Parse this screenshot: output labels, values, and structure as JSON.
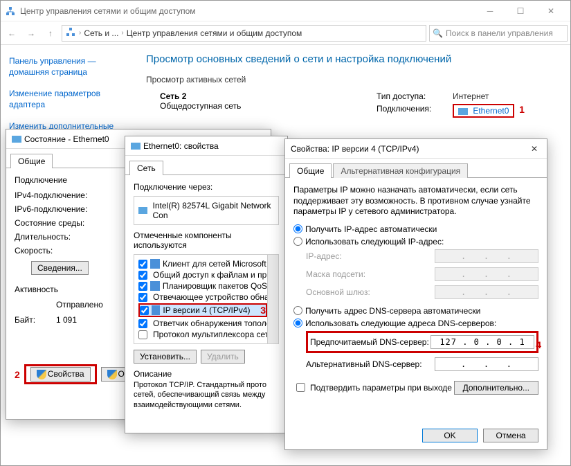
{
  "main_window": {
    "title": "Центр управления сетями и общим доступом",
    "breadcrumb": {
      "seg1": "Сеть и ...",
      "seg2": "Центр управления сетями и общим доступом"
    },
    "search_placeholder": "Поиск в панели управления",
    "sidebar": {
      "home": "Панель управления — домашняя страница",
      "adapter": "Изменение параметров адаптера",
      "sharing": "Изменить дополнительные"
    },
    "heading": "Просмотр основных сведений о сети и настройка подключений",
    "active_nets_label": "Просмотр активных сетей",
    "net_name": "Сеть 2",
    "net_type": "Общедоступная сеть",
    "access_lbl": "Тип доступа:",
    "access_val": "Интернет",
    "conns_lbl": "Подключения:",
    "conns_val": "Ethernet0"
  },
  "status_dlg": {
    "title": "Состояние - Ethernet0",
    "tab_general": "Общие",
    "connection_group": "Подключение",
    "ipv4_lbl": "IPv4-подключение:",
    "ipv6_lbl": "IPv6-подключение:",
    "media_lbl": "Состояние среды:",
    "duration_lbl": "Длительность:",
    "speed_lbl": "Скорость:",
    "details_btn": "Сведения...",
    "activity_group": "Активность",
    "sent_lbl": "Отправлено",
    "bytes_lbl": "Байт:",
    "bytes_sent": "1 091",
    "props_btn": "Свойства",
    "disable_btn": "Отключ"
  },
  "props_dlg": {
    "title": "Ethernet0: свойства",
    "tab_network": "Сеть",
    "connect_using_lbl": "Подключение через:",
    "adapter": "Intel(R) 82574L Gigabit Network Con",
    "components_lbl": "Отмеченные компоненты используются",
    "items": [
      "Клиент для сетей Microsoft",
      "Общий доступ к файлам и принт",
      "Планировщик пакетов QoS",
      "Отвечающее устройство обнару",
      "IP версии 4 (TCP/IPv4)",
      "Ответчик обнаружения тополог",
      "Протокол мультиплексора сете"
    ],
    "install_btn": "Установить...",
    "remove_btn": "Удалить",
    "desc_lbl": "Описание",
    "desc_text": "Протокол TCP/IP. Стандартный прото сетей, обеспечивающий связь между взаимодействующими сетями."
  },
  "ipv4_dlg": {
    "title": "Свойства: IP версии 4 (TCP/IPv4)",
    "tab_general": "Общие",
    "tab_alt": "Альтернативная конфигурация",
    "intro": "Параметры IP можно назначать автоматически, если сеть поддерживает эту возможность. В противном случае узнайте параметры IP у сетевого администратора.",
    "ip_auto": "Получить IP-адрес автоматически",
    "ip_manual": "Использовать следующий IP-адрес:",
    "ip_lbl": "IP-адрес:",
    "mask_lbl": "Маска подсети:",
    "gw_lbl": "Основной шлюз:",
    "dns_auto": "Получить адрес DNS-сервера автоматически",
    "dns_manual": "Использовать следующие адреса DNS-серверов:",
    "dns1_lbl": "Предпочитаемый DNS-сервер:",
    "dns1_val": "127 . 0 . 0 . 1",
    "dns2_lbl": "Альтернативный DNS-сервер:",
    "validate_lbl": "Подтвердить параметры при выходе",
    "advanced_btn": "Дополнительно...",
    "ok_btn": "OK",
    "cancel_btn": "Отмена"
  },
  "annot": {
    "n1": "1",
    "n2": "2",
    "n3": "3",
    "n4": "4"
  }
}
